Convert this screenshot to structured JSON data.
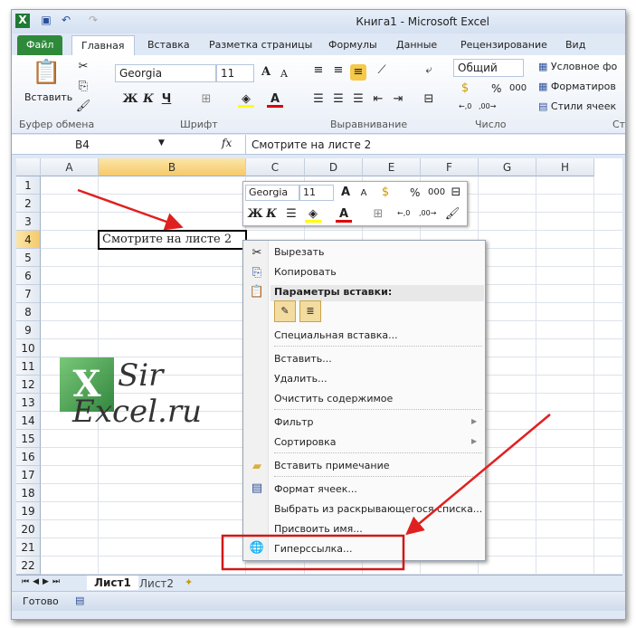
{
  "window": {
    "title": "Книга1  -  Microsoft Excel"
  },
  "tabs": [
    "Файл",
    "Главная",
    "Вставка",
    "Разметка страницы",
    "Формулы",
    "Данные",
    "Рецензирование",
    "Вид"
  ],
  "ribbon": {
    "paste": "Вставить",
    "font_name": "Georgia",
    "font_size": "11",
    "bold": "Ж",
    "italic": "К",
    "underline": "Ч",
    "number_format": "Общий",
    "percent": "%",
    "thousands": "000",
    "cond_format": "Условное фо",
    "format_table": "Форматиров",
    "cell_styles": "Стили ячеек",
    "groups": [
      "Буфер обмена",
      "Шрифт",
      "Выравнивание",
      "Число",
      "Ст"
    ]
  },
  "formula_bar": {
    "name_box": "B4",
    "fx": "fx",
    "value": "Смотрите на листе 2"
  },
  "columns": [
    "A",
    "B",
    "C",
    "D",
    "E",
    "F",
    "G",
    "H"
  ],
  "rows": [
    "1",
    "2",
    "3",
    "4",
    "5",
    "6",
    "7",
    "8",
    "9",
    "10",
    "11",
    "12",
    "13",
    "14",
    "15",
    "16",
    "17",
    "18",
    "19",
    "20",
    "21",
    "22"
  ],
  "cell_b4": "Смотрите на листе 2",
  "mini_toolbar": {
    "font": "Georgia",
    "size": "11",
    "percent": "%",
    "thousands": "000",
    "bold": "Ж",
    "italic": "К"
  },
  "context_menu": {
    "items": [
      "Вырезать",
      "Копировать",
      "Параметры вставки:",
      "Специальная вставка...",
      "Вставить...",
      "Удалить...",
      "Очистить содержимое",
      "Фильтр",
      "Сортировка",
      "Вставить примечание",
      "Формат ячеек...",
      "Выбрать из раскрывающегося списка...",
      "Присвоить имя...",
      "Гиперссылка..."
    ]
  },
  "sheets": [
    "Лист1",
    "Лист2"
  ],
  "status": "Готово",
  "watermark": "Sir Excel.ru",
  "colors": {
    "accent_red": "#e02020",
    "file_tab": "#2e8a3a",
    "selection": "#f5d58a"
  }
}
